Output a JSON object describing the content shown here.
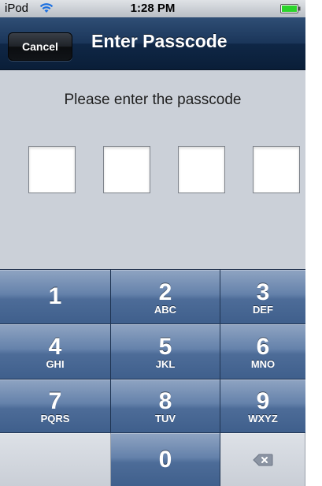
{
  "status_bar": {
    "carrier": "iPod",
    "wifi_icon": "wifi-icon",
    "time": "1:28 PM",
    "battery_icon": "battery-icon",
    "battery_color": "#2bd42b"
  },
  "nav_bar": {
    "cancel_label": "Cancel",
    "title": "Enter Passcode"
  },
  "content": {
    "prompt": "Please enter the passcode",
    "passcode_fields": [
      "",
      "",
      "",
      ""
    ]
  },
  "keypad": {
    "keys": [
      {
        "digit": "1",
        "letters": ""
      },
      {
        "digit": "2",
        "letters": "ABC"
      },
      {
        "digit": "3",
        "letters": "DEF"
      },
      {
        "digit": "4",
        "letters": "GHI"
      },
      {
        "digit": "5",
        "letters": "JKL"
      },
      {
        "digit": "6",
        "letters": "MNO"
      },
      {
        "digit": "7",
        "letters": "PQRS"
      },
      {
        "digit": "8",
        "letters": "TUV"
      },
      {
        "digit": "9",
        "letters": "WXYZ"
      },
      {
        "digit": "0",
        "letters": ""
      }
    ],
    "delete_icon": "backspace-icon"
  }
}
